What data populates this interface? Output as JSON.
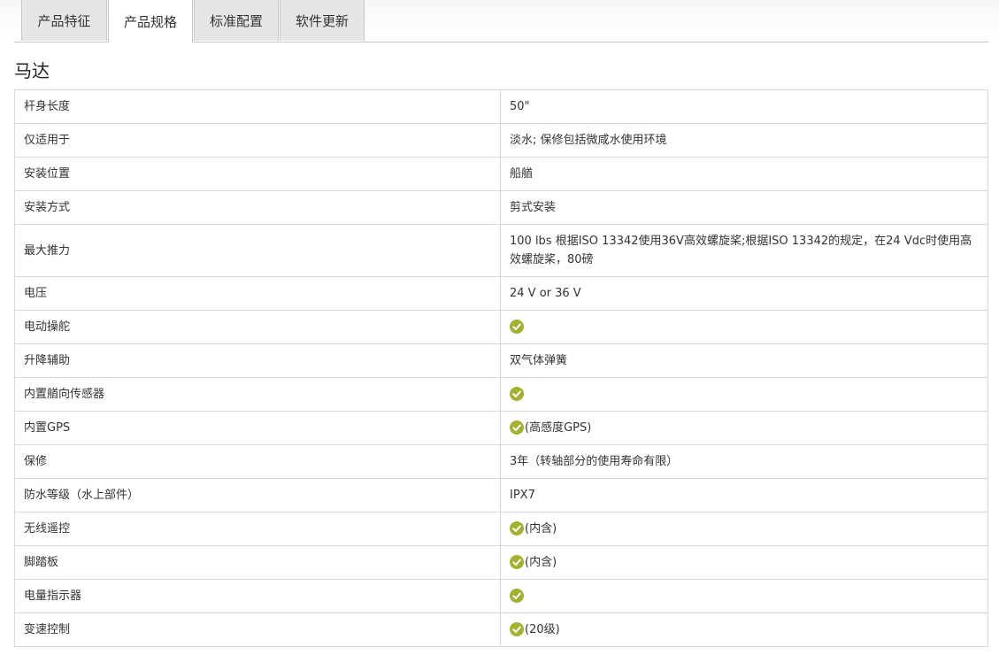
{
  "tabs": [
    {
      "label": "产品特征",
      "active": false
    },
    {
      "label": "产品规格",
      "active": true
    },
    {
      "label": "标准配置",
      "active": false
    },
    {
      "label": "软件更新",
      "active": false
    }
  ],
  "section_title": "马达",
  "check_color": "#a3b030",
  "rows": [
    {
      "label": "杆身长度",
      "value": "50\"",
      "check": false
    },
    {
      "label": "仅适用于",
      "value": "淡水; 保修包括微咸水使用环境",
      "check": false
    },
    {
      "label": "安装位置",
      "value": "船艏",
      "check": false
    },
    {
      "label": "安装方式",
      "value": "剪式安装",
      "check": false
    },
    {
      "label": "最大推力",
      "value": "100 lbs 根据ISO 13342使用36V高效螺旋桨;根据ISO 13342的规定，在24 Vdc时使用高效螺旋桨，80磅",
      "check": false
    },
    {
      "label": "电压",
      "value": "24 V or 36 V",
      "check": false
    },
    {
      "label": "电动操舵",
      "value": "",
      "check": true
    },
    {
      "label": "升降辅助",
      "value": "双气体弹簧",
      "check": false
    },
    {
      "label": "内置艏向传感器",
      "value": "",
      "check": true
    },
    {
      "label": "内置GPS",
      "value": "(高感度GPS)",
      "check": true
    },
    {
      "label": "保修",
      "value": "3年（转轴部分的使用寿命有限）",
      "check": false
    },
    {
      "label": "防水等级（水上部件）",
      "value": "IPX7",
      "check": false
    },
    {
      "label": "无线遥控",
      "value": "(内含)",
      "check": true
    },
    {
      "label": "脚踏板",
      "value": "(内含)",
      "check": true
    },
    {
      "label": "电量指示器",
      "value": "",
      "check": true
    },
    {
      "label": "变速控制",
      "value": "(20级)",
      "check": true
    }
  ]
}
